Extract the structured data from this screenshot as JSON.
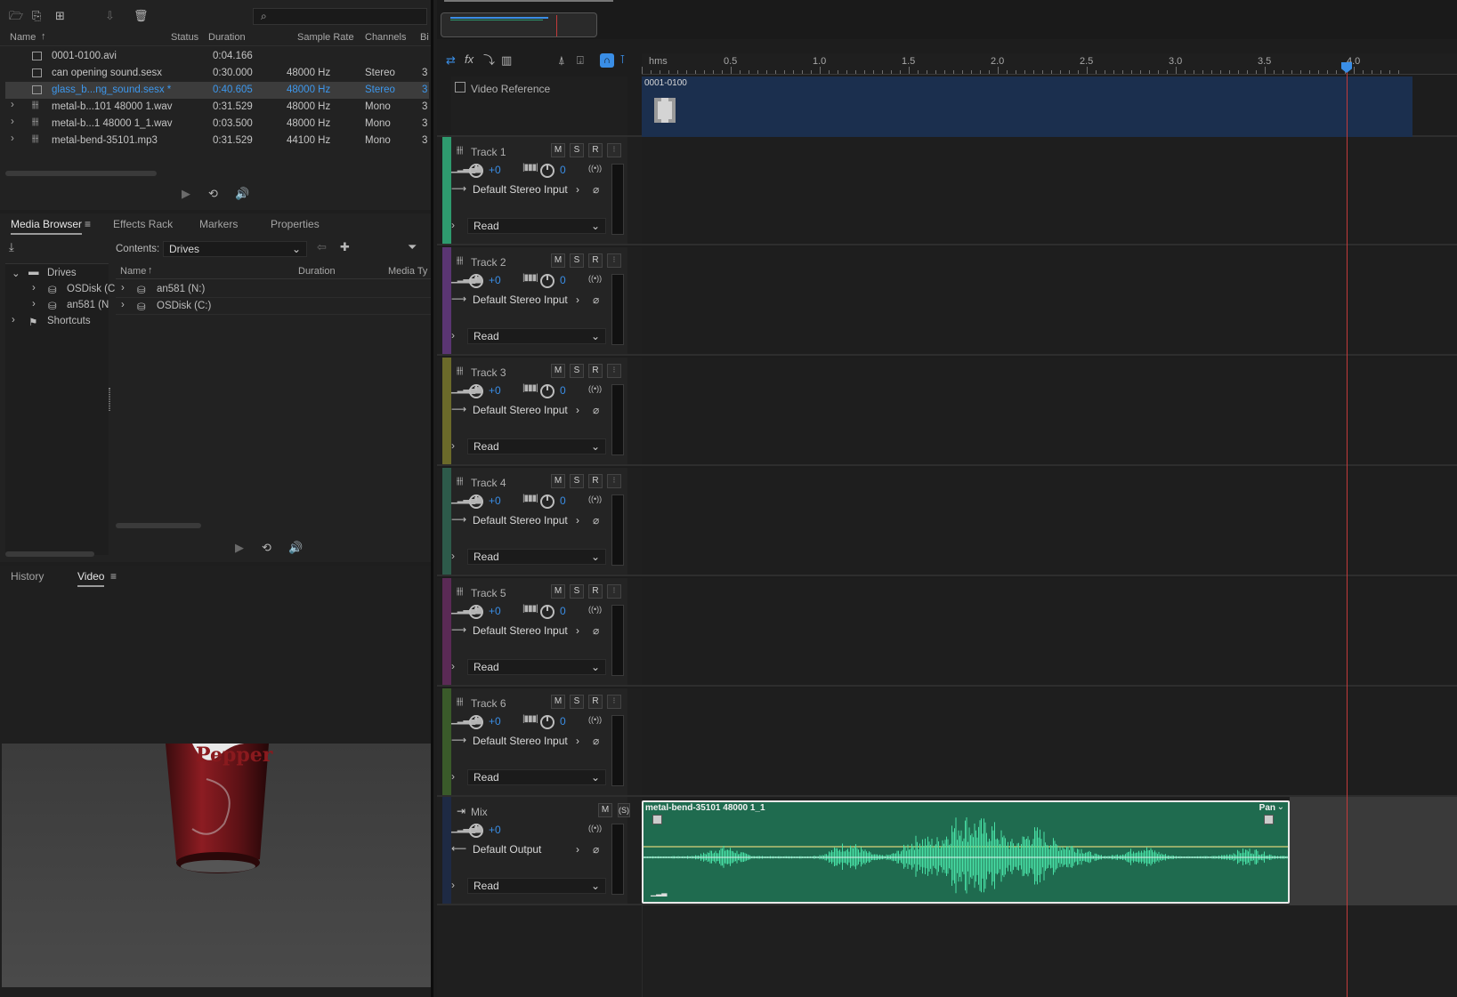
{
  "files": {
    "columns": [
      "Name",
      "Status",
      "Duration",
      "Sample Rate",
      "Channels",
      "Bi"
    ],
    "rows": [
      {
        "name": "0001-0100.avi",
        "duration": "0:04.166",
        "sample_rate": "",
        "channels": "",
        "bits": "",
        "type": "video"
      },
      {
        "name": "can opening sound.sesx",
        "duration": "0:30.000",
        "sample_rate": "48000 Hz",
        "channels": "Stereo",
        "bits": "3",
        "type": "session"
      },
      {
        "name": "glass_b...ng_sound.sesx *",
        "duration": "0:40.605",
        "sample_rate": "48000 Hz",
        "channels": "Stereo",
        "bits": "3",
        "type": "session",
        "selected": true
      },
      {
        "name": "metal-b...101 48000 1.wav",
        "duration": "0:31.529",
        "sample_rate": "48000 Hz",
        "channels": "Mono",
        "bits": "3",
        "type": "audio"
      },
      {
        "name": "metal-b...1 48000 1_1.wav",
        "duration": "0:03.500",
        "sample_rate": "48000 Hz",
        "channels": "Mono",
        "bits": "3",
        "type": "audio"
      },
      {
        "name": "metal-bend-35101.mp3",
        "duration": "0:31.529",
        "sample_rate": "44100 Hz",
        "channels": "Mono",
        "bits": "3",
        "type": "audio"
      }
    ]
  },
  "panel_tabs": {
    "media_browser": "Media Browser",
    "effects_rack": "Effects Rack",
    "markers": "Markers",
    "properties": "Properties"
  },
  "media_browser": {
    "contents_label": "Contents:",
    "contents_value": "Drives",
    "tree": [
      "Drives",
      "OSDisk (C",
      "an581 (N",
      "Shortcuts"
    ],
    "columns": [
      "Name",
      "Duration",
      "Media Ty"
    ],
    "items": [
      "an581 (N:)",
      "OSDisk (C:)"
    ]
  },
  "bottom_tabs": {
    "history": "History",
    "video": "Video"
  },
  "video_frame": {
    "can_text": "Pepper"
  },
  "ruler": {
    "unit": "hms",
    "labels": [
      "0.5",
      "1.0",
      "1.5",
      "2.0",
      "2.5",
      "3.0",
      "3.5",
      "4.0"
    ]
  },
  "video_reference": {
    "label": "Video Reference",
    "clip_name": "0001-0100"
  },
  "tracks": [
    {
      "name": "Track 1",
      "color": "#2e9a6e",
      "volume": "+0",
      "pan": "0",
      "input": "Default Stereo Input",
      "automation": "Read"
    },
    {
      "name": "Track 2",
      "color": "#5a3572",
      "volume": "+0",
      "pan": "0",
      "input": "Default Stereo Input",
      "automation": "Read"
    },
    {
      "name": "Track 3",
      "color": "#6b6a2a",
      "volume": "+0",
      "pan": "0",
      "input": "Default Stereo Input",
      "automation": "Read"
    },
    {
      "name": "Track 4",
      "color": "#2d5a4a",
      "volume": "+0",
      "pan": "0",
      "input": "Default Stereo Input",
      "automation": "Read"
    },
    {
      "name": "Track 5",
      "color": "#5a2a55",
      "volume": "+0",
      "pan": "0",
      "input": "Default Stereo Input",
      "automation": "Read"
    },
    {
      "name": "Track 6",
      "color": "#3a5a2a",
      "volume": "+0",
      "pan": "0",
      "input": "Default Stereo Input",
      "automation": "Read"
    }
  ],
  "mix": {
    "name": "Mix",
    "volume": "+0",
    "output": "Default Output",
    "automation": "Read"
  },
  "clip": {
    "name": "metal-bend-35101 48000 1_1",
    "pan_label": "Pan"
  },
  "buttons": {
    "m": "M",
    "s": "S",
    "r": "R",
    "s_paren": "(S)"
  },
  "colors": {
    "accent_blue": "#3a8ee6",
    "clip_green": "#1f6b4f",
    "waveform": "#48e0a6",
    "playhead": "#c23b3b",
    "video_clip": "#1b2f4e"
  }
}
